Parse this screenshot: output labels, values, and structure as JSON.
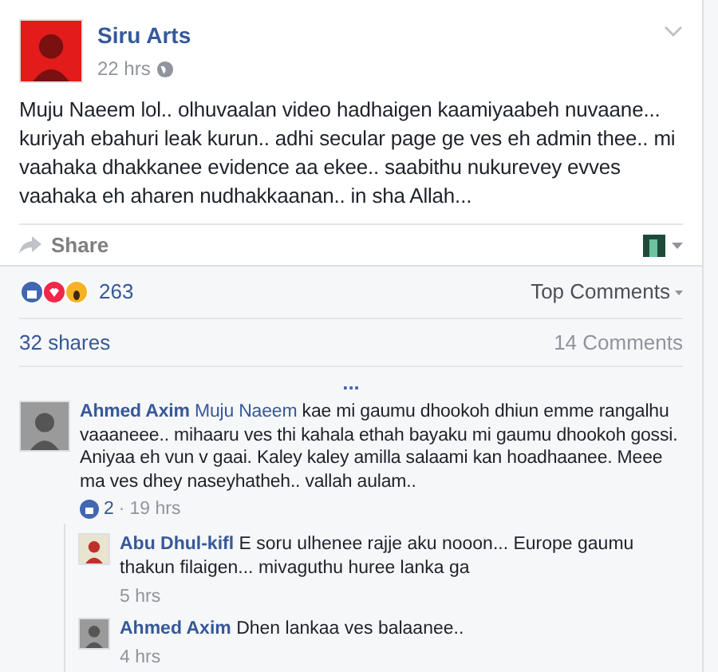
{
  "post": {
    "author": "Siru Arts",
    "time": "22 hrs",
    "text": "Muju Naeem lol.. olhuvaalan video hadhaigen kaamiyaabeh nuvaane... kuriyah ebahuri leak kurun.. adhi secular page ge ves eh admin thee.. mi vaahaka dhakkanee evidence aa ekee.. saabithu nukurevey evves vaahaka eh aharen nudhakkaanan.. in sha Allah...",
    "share": "Share"
  },
  "summary": {
    "reaction_count": "263",
    "sort": "Top Comments",
    "shares": "32 shares",
    "comments": "14 Comments"
  },
  "more": "...",
  "comments": [
    {
      "author": "Ahmed Axim",
      "tag": "Muju Naeem",
      "text": "kae mi gaumu dhookoh dhiun emme rangalhu vaaaneee.. mihaaru ves thi kahala ethah bayaku mi gaumu dhookoh gossi. Aniyaa eh vun v gaai. Kaley kaley amilla salaami kan hoadhaanee. Meee ma ves dhey naseyhatheh.. vallah aulam..",
      "likes": "2",
      "separator": "·",
      "time": "19 hrs",
      "replies": [
        {
          "author": "Abu Dhul-kifl",
          "text": "E soru ulhenee rajje aku nooon... Europe gaumu thakun filaigen... mivaguthu huree lanka ga",
          "time": "5 hrs"
        },
        {
          "author": "Ahmed Axim",
          "text": "Dhen lankaa ves balaanee..",
          "time": "4 hrs"
        }
      ]
    }
  ]
}
